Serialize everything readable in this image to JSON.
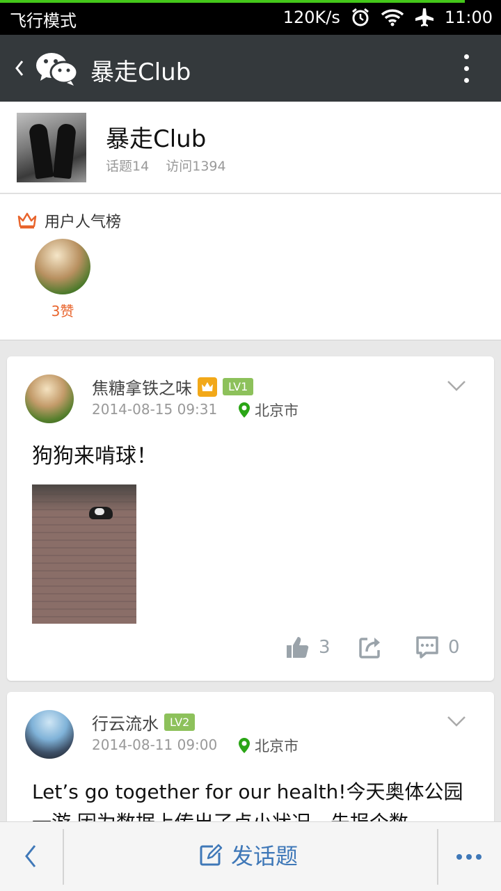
{
  "status_bar": {
    "mode": "飞行模式",
    "speed": "120K/s",
    "time": "11:00",
    "icons": [
      "alarm-icon",
      "wifi-icon",
      "airplane-icon"
    ]
  },
  "title_bar": {
    "title": "暴走Club",
    "icons": [
      "back-icon",
      "wechat-icon",
      "more-icon"
    ]
  },
  "club": {
    "name": "暴走Club",
    "topics": "话题14",
    "visits": "访问1394"
  },
  "ranking": {
    "label": "用户人气榜",
    "users": [
      {
        "likes": "3赞"
      }
    ]
  },
  "posts": [
    {
      "username": "焦糖拿铁之味",
      "level": "LV1",
      "has_vip_badge": true,
      "time": "2014-08-15 09:31",
      "location": "北京市",
      "content": "狗狗来啃球！",
      "likes": "3",
      "comments": "0"
    },
    {
      "username": "行云流水",
      "level": "LV2",
      "has_vip_badge": false,
      "time": "2014-08-11 09:00",
      "location": "北京市",
      "content": "Let’s go together for our health!今天奥体公园一游,因为数据上传出了点小状况，先报个数"
    }
  ],
  "bottom_bar": {
    "post_label": "发话题"
  },
  "colors": {
    "title_bar": "#34393c",
    "accent_blue": "#3f78b8",
    "likes_orange": "#e8642c",
    "level_green": "#8dc15b",
    "location_green": "#2aa515"
  }
}
